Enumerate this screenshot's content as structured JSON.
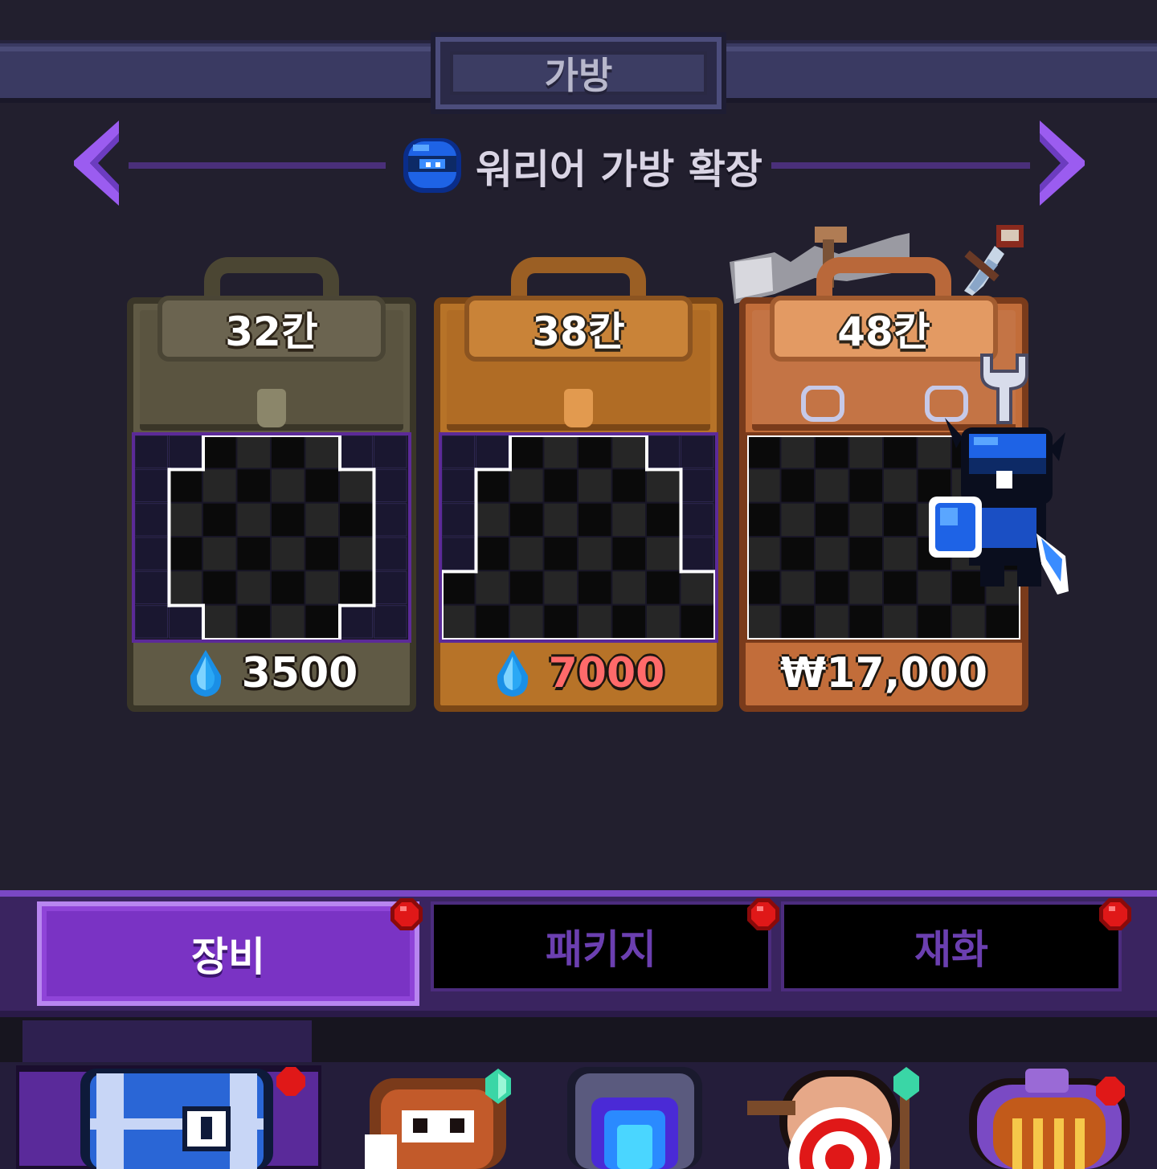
{
  "header": {
    "title": "가방"
  },
  "subheader": {
    "title": "워리어 가방 확장"
  },
  "bags": [
    {
      "slots": "32칸",
      "price": "3500",
      "currency_icon": "water-drop-gem-icon",
      "price_color": "#ffffff"
    },
    {
      "slots": "38칸",
      "price": "7000",
      "currency_icon": "water-drop-gem-icon",
      "price_color": "#ff6a6a"
    },
    {
      "slots": "48칸",
      "price": "₩17,000",
      "currency_icon": null,
      "price_color": "#ffffff"
    }
  ],
  "tabs": [
    {
      "label": "장비",
      "active": true,
      "has_notification": true
    },
    {
      "label": "패키지",
      "active": false,
      "has_notification": true
    },
    {
      "label": "재화",
      "active": false,
      "has_notification": true
    }
  ],
  "bottom_items": [
    {
      "icon": "blue-treasure-chest-icon",
      "selected": true,
      "has_notification": true
    },
    {
      "icon": "fox-bag-icon",
      "badge": "green-gem-icon"
    },
    {
      "icon": "portal-door-icon"
    },
    {
      "icon": "target-sack-icon",
      "badge": "green-gem-icon"
    },
    {
      "icon": "arched-gate-icon",
      "has_notification": true
    }
  ],
  "colors": {
    "background": "#221f2e",
    "tab_active": "#7a33c4",
    "accent_purple": "#9b5cf0",
    "notification_red": "#e01818"
  }
}
